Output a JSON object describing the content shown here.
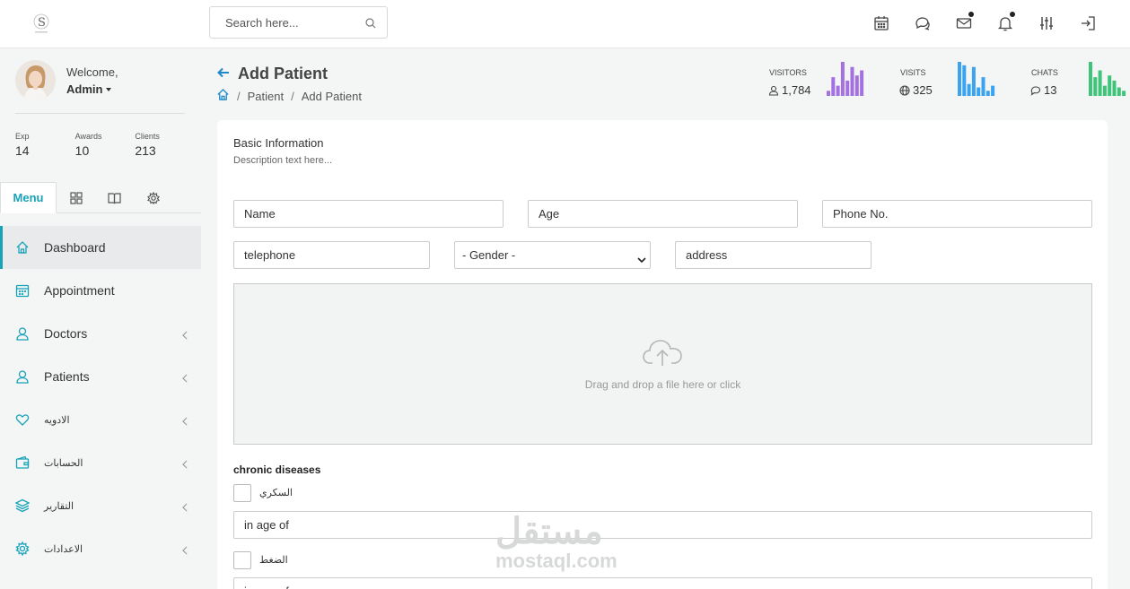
{
  "header": {
    "search_placeholder": "Search here...",
    "icons": [
      "calendar-icon",
      "chat-icon",
      "mail-icon",
      "bell-icon",
      "sliders-icon",
      "logout-icon"
    ]
  },
  "sidebar": {
    "welcome": "Welcome,",
    "user": "Admin",
    "stats": [
      {
        "label": "Exp",
        "value": "14"
      },
      {
        "label": "Awards",
        "value": "10"
      },
      {
        "label": "Clients",
        "value": "213"
      }
    ],
    "tab_menu": "Menu",
    "items": [
      {
        "label": "Dashboard",
        "icon": "home-icon"
      },
      {
        "label": "Appointment",
        "icon": "calendar-icon"
      },
      {
        "label": "Doctors",
        "icon": "user-icon"
      },
      {
        "label": "Patients",
        "icon": "user-icon"
      },
      {
        "label": "الادويه",
        "icon": "heart-icon"
      },
      {
        "label": "الحسابات",
        "icon": "wallet-icon"
      },
      {
        "label": "التقارير",
        "icon": "layers-icon"
      },
      {
        "label": "الاعدادات",
        "icon": "settings-icon"
      }
    ]
  },
  "page": {
    "title": "Add Patient",
    "breadcrumb": [
      "Patient",
      "Add Patient"
    ],
    "stats": [
      {
        "label": "VISITORS",
        "value": "1,784",
        "color": "#a472e0",
        "bars": [
          0.15,
          0.55,
          0.3,
          1.0,
          0.45,
          0.85,
          0.6,
          0.75
        ]
      },
      {
        "label": "VISITS",
        "value": "325",
        "color": "#3ba4f0",
        "bars": [
          1.0,
          0.9,
          0.35,
          0.85,
          0.25,
          0.55,
          0.15,
          0.3
        ]
      },
      {
        "label": "CHATS",
        "value": "13",
        "color": "#3fc47a",
        "bars": [
          1.0,
          0.55,
          0.75,
          0.3,
          0.6,
          0.45,
          0.25,
          0.15
        ]
      }
    ]
  },
  "form": {
    "title": "Basic Information",
    "description": "Description text here...",
    "name_placeholder": "Name",
    "age_placeholder": "Age",
    "phone_placeholder": "Phone No.",
    "telephone_placeholder": "telephone",
    "gender_selected": "- Gender -",
    "address_placeholder": "address",
    "dropzone_text": "Drag and drop a file here or click",
    "chronic_title": "chronic diseases",
    "diabetes_label": "السكري",
    "age_of_placeholder": "in age of",
    "pressure_label": "الضغط"
  },
  "watermark": {
    "arabic": "مستقل",
    "latin": "mostaql.com"
  }
}
